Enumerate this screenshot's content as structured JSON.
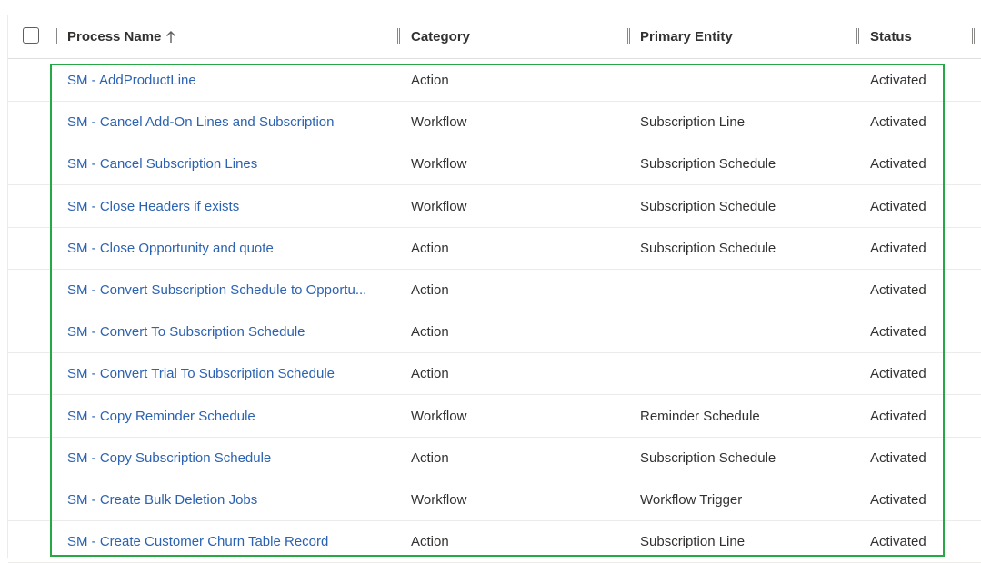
{
  "header": {
    "columns": [
      {
        "key": "name",
        "label": "Process Name"
      },
      {
        "key": "category",
        "label": "Category"
      },
      {
        "key": "entity",
        "label": "Primary Entity"
      },
      {
        "key": "status",
        "label": "Status"
      }
    ],
    "sort_icon": "arrow-up-icon",
    "select_all_icon": "checkbox-icon"
  },
  "rows": [
    {
      "name": "SM - AddProductLine",
      "category": "Action",
      "entity": "",
      "status": "Activated"
    },
    {
      "name": "SM - Cancel Add-On Lines and Subscription",
      "category": "Workflow",
      "entity": "Subscription Line",
      "status": "Activated"
    },
    {
      "name": "SM - Cancel Subscription Lines",
      "category": "Workflow",
      "entity": "Subscription Schedule",
      "status": "Activated"
    },
    {
      "name": "SM - Close Headers if exists",
      "category": "Workflow",
      "entity": "Subscription Schedule",
      "status": "Activated"
    },
    {
      "name": "SM - Close Opportunity and quote",
      "category": "Action",
      "entity": "Subscription Schedule",
      "status": "Activated"
    },
    {
      "name": "SM - Convert Subscription Schedule to Opportu...",
      "category": "Action",
      "entity": "",
      "status": "Activated"
    },
    {
      "name": "SM - Convert To Subscription Schedule",
      "category": "Action",
      "entity": "",
      "status": "Activated"
    },
    {
      "name": "SM - Convert Trial To Subscription Schedule",
      "category": "Action",
      "entity": "",
      "status": "Activated"
    },
    {
      "name": "SM - Copy Reminder Schedule",
      "category": "Workflow",
      "entity": "Reminder Schedule",
      "status": "Activated"
    },
    {
      "name": "SM - Copy Subscription Schedule",
      "category": "Action",
      "entity": "Subscription Schedule",
      "status": "Activated"
    },
    {
      "name": "SM - Create Bulk Deletion Jobs",
      "category": "Workflow",
      "entity": "Workflow Trigger",
      "status": "Activated"
    },
    {
      "name": "SM - Create Customer Churn Table Record",
      "category": "Action",
      "entity": "Subscription Line",
      "status": "Activated"
    }
  ],
  "colors": {
    "link": "#2b62b2",
    "highlight": "#27a844",
    "text": "#323130"
  }
}
